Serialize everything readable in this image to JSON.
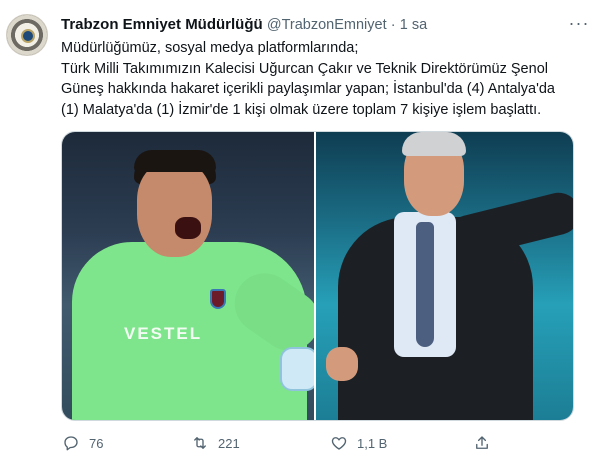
{
  "tweet": {
    "author_name": "Trabzon Emniyet Müdürlüğü",
    "author_handle": "@TrabzonEmniyet",
    "separator": "·",
    "time": "1 sa",
    "text_lines": [
      "Müdürlüğümüz, sosyal medya platformlarında;",
      "Türk Milli Takımımızın Kalecisi Uğurcan Çakır ve Teknik Direktörümüz Şenol",
      "Güneş hakkında hakaret içerikli paylaşımlar yapan; İstanbul'da (4) Antalya'da",
      "(1) Malatya'da (1) İzmir'de 1 kişi olmak üzere toplam 7 kişiye işlem başlattı."
    ],
    "media": [
      {
        "subject": "goalkeeper",
        "shirt_text": "VESTEL"
      },
      {
        "subject": "coach"
      }
    ],
    "actions": {
      "reply_count": "76",
      "retweet_count": "221",
      "like_count": "1,1 B",
      "share_count": ""
    },
    "icons": {
      "avatar": "police-badge-avatar",
      "more": "more-icon",
      "reply": "reply-icon",
      "retweet": "retweet-icon",
      "like": "heart-icon",
      "share": "share-icon"
    }
  }
}
